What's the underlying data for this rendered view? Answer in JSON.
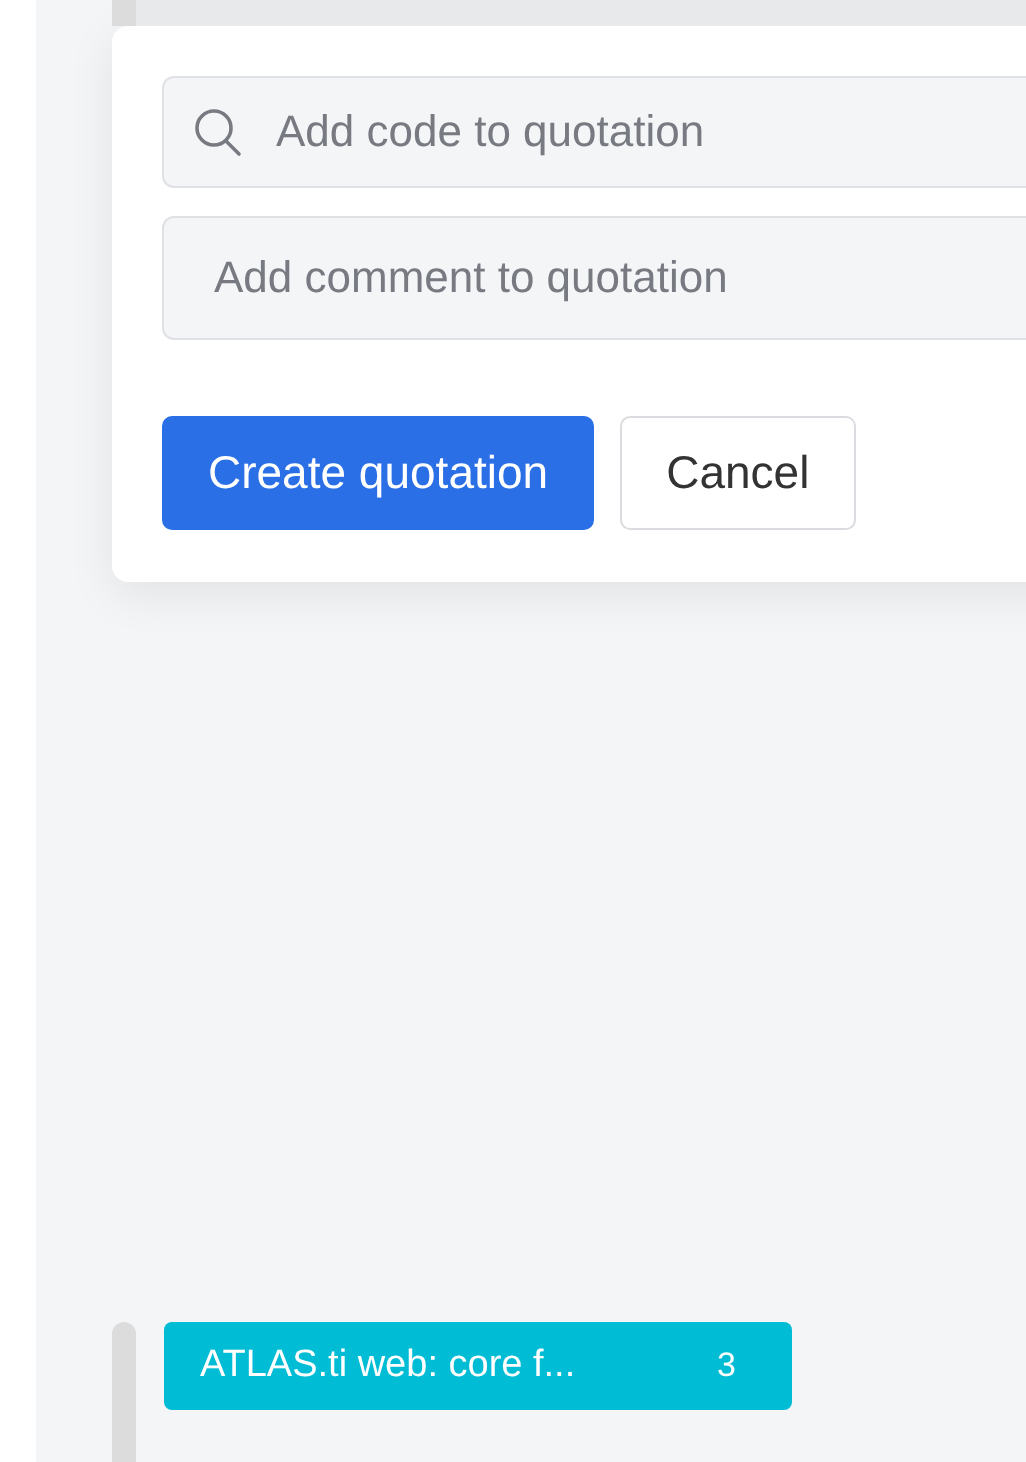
{
  "quotation_form": {
    "code_search": {
      "placeholder": "Add code to quotation"
    },
    "comment": {
      "placeholder": "Add comment to quotation"
    },
    "buttons": [
      {
        "label": "Create quotation",
        "kind": "primary"
      },
      {
        "label": "Cancel",
        "kind": "secondary"
      }
    ]
  },
  "code_tag": {
    "label": "ATLAS.ti web: core f...",
    "count": "3",
    "color": "#00bcd4"
  }
}
